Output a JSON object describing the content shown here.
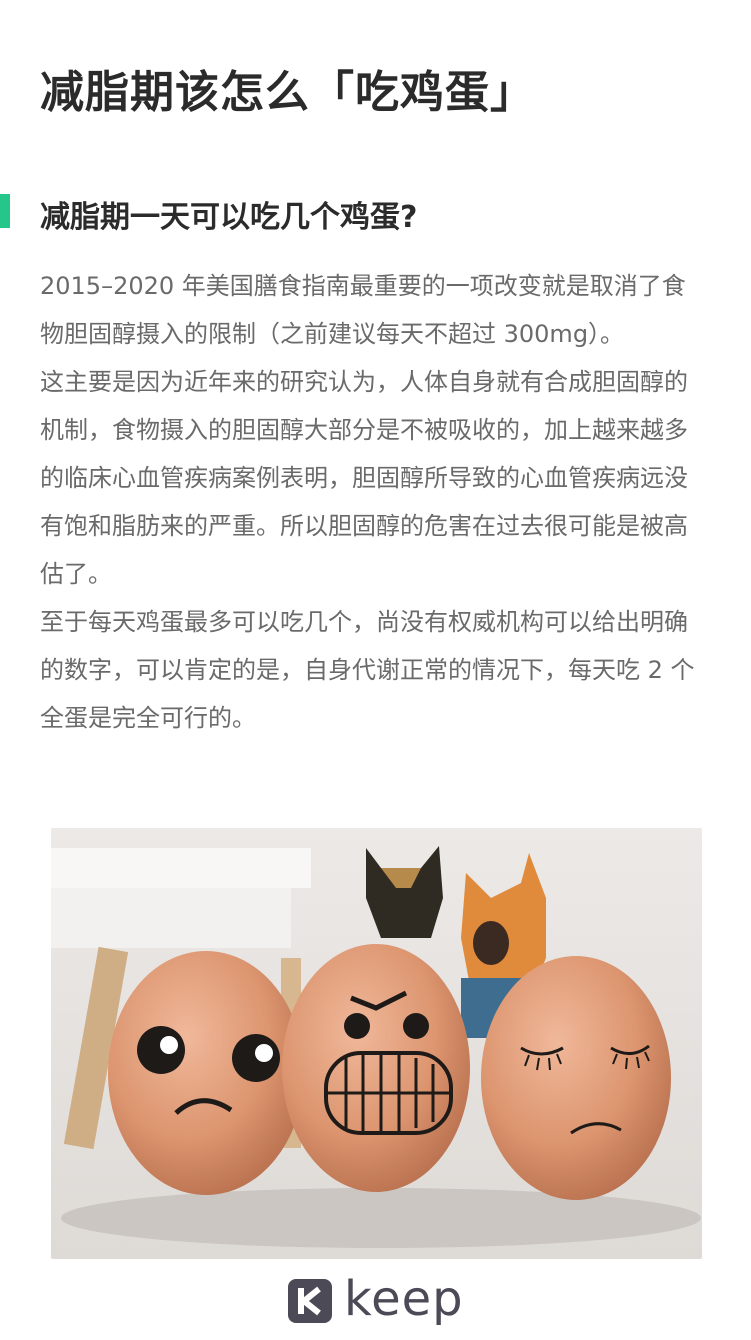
{
  "article": {
    "title": "减脂期该怎么「吃鸡蛋」",
    "section_title": "减脂期一天可以吃几个鸡蛋?",
    "paragraphs": [
      "2015–2020 年美国膳食指南最重要的一项改变就是取消了食物胆固醇摄入的限制（之前建议每天不超过 300mg）。",
      "这主要是因为近年来的研究认为，人体自身就有合成胆固醇的机制，食物摄入的胆固醇大部分是不被吸收的，加上越来越多的临床心血管疾病案例表明，胆固醇所导致的心血管疾病远没有饱和脂肪来的严重。所以胆固醇的危害在过去很可能是被高估了。",
      "至于每天鸡蛋最多可以吃几个，尚没有权威机构可以给出明确的数字，可以肯定的是，自身代谢正常的情况下，每天吃 2 个全蛋是完全可行的。"
    ]
  },
  "brand": {
    "name": "keep",
    "color": "#4d4a57",
    "accent": "#24c789"
  }
}
